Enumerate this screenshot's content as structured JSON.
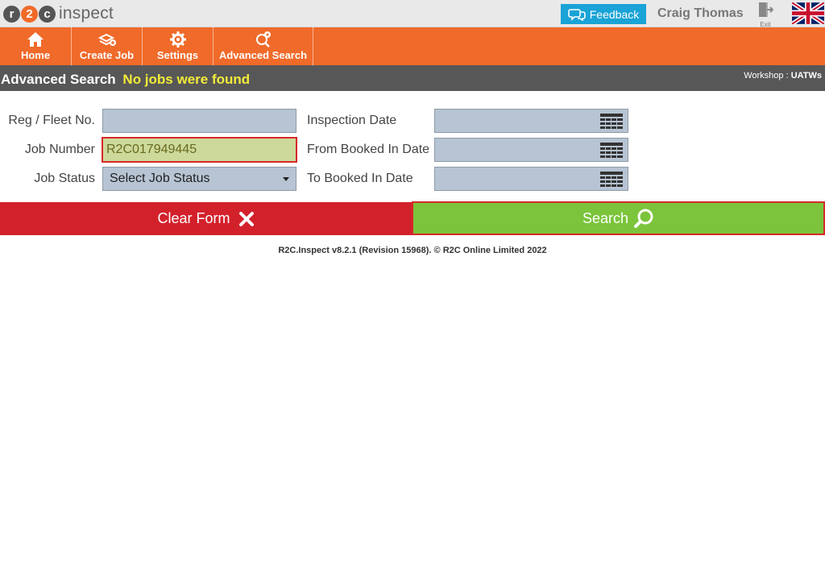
{
  "header": {
    "logo": {
      "letters": [
        "r",
        "2",
        "c"
      ],
      "word": "inspect"
    },
    "feedback_label": "Feedback",
    "user_name": "Craig Thomas",
    "exit_label": "Exit",
    "language_flag": "uk-flag-icon"
  },
  "nav": {
    "items": [
      {
        "label": "Home",
        "icon": "home-icon"
      },
      {
        "label": "Create Job",
        "icon": "create-job-icon"
      },
      {
        "label": "Settings",
        "icon": "gear-icon"
      },
      {
        "label": "Advanced Search",
        "icon": "advanced-search-icon"
      }
    ]
  },
  "titlebar": {
    "title": "Advanced Search",
    "status": "No jobs were found",
    "workshop_label": "Workshop :",
    "workshop_value": "UATWs"
  },
  "form": {
    "reg_label": "Reg / Fleet No.",
    "reg_value": "",
    "job_number_label": "Job Number",
    "job_number_value": "R2C017949445",
    "job_status_label": "Job Status",
    "job_status_value": "Select Job Status",
    "inspection_date_label": "Inspection Date",
    "inspection_date_value": "",
    "from_booked_label": "From Booked In Date",
    "from_booked_value": "",
    "to_booked_label": "To Booked In Date",
    "to_booked_value": ""
  },
  "actions": {
    "clear_label": "Clear Form",
    "search_label": "Search"
  },
  "footer": {
    "text": "R2C.Inspect v8.2.1 (Revision 15968). © R2C Online Limited 2022"
  },
  "colors": {
    "nav_orange": "#f06a2a",
    "title_bar": "#575757",
    "status_yellow": "#f3ec3a",
    "feedback_blue": "#19a3d6",
    "clear_red": "#d3212c",
    "search_green": "#7bc43b",
    "field_blue_gray": "#b7c4d3",
    "highlight_field": "#ccd99b"
  }
}
